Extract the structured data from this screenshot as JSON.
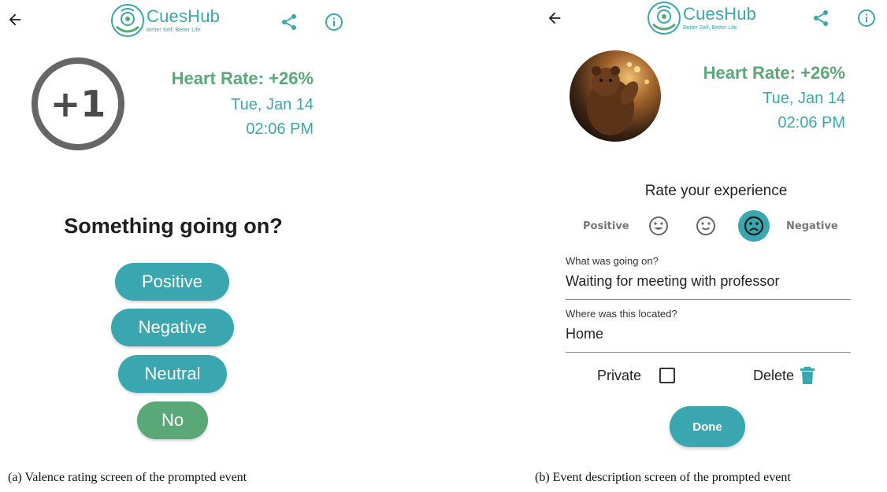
{
  "colors": {
    "teal": "#3aa7b0",
    "green": "#5aa877",
    "ring": "#666666"
  },
  "header": {
    "back_icon": "arrow-left-icon",
    "logo_name": "CuesHub",
    "logo_tag": "Better Self, Better Life",
    "share_icon": "share-icon",
    "info_icon": "info-icon"
  },
  "screen_a": {
    "badge": "+1",
    "heart_rate": "Heart Rate: +26%",
    "date": "Tue, Jan 14",
    "time": "02:06 PM",
    "question": "Something going on?",
    "options": [
      "Positive",
      "Negative",
      "Neutral",
      "No"
    ],
    "caption": "(a) Valence rating screen of the prompted event"
  },
  "screen_b": {
    "heart_rate": "Heart Rate: +26%",
    "date": "Tue, Jan 14",
    "time": "02:06 PM",
    "rate_title": "Rate your experience",
    "scale_positive": "Positive",
    "scale_negative": "Negative",
    "selected_face": "sad",
    "what_label": "What was going on?",
    "what_value": "Waiting for meeting with professor",
    "where_label": "Where was this located?",
    "where_value": "Home",
    "private_label": "Private",
    "private_checked": false,
    "delete_label": "Delete",
    "delete_icon": "trash-icon",
    "done_label": "Done",
    "caption": "(b) Event description screen of the prompted event"
  }
}
